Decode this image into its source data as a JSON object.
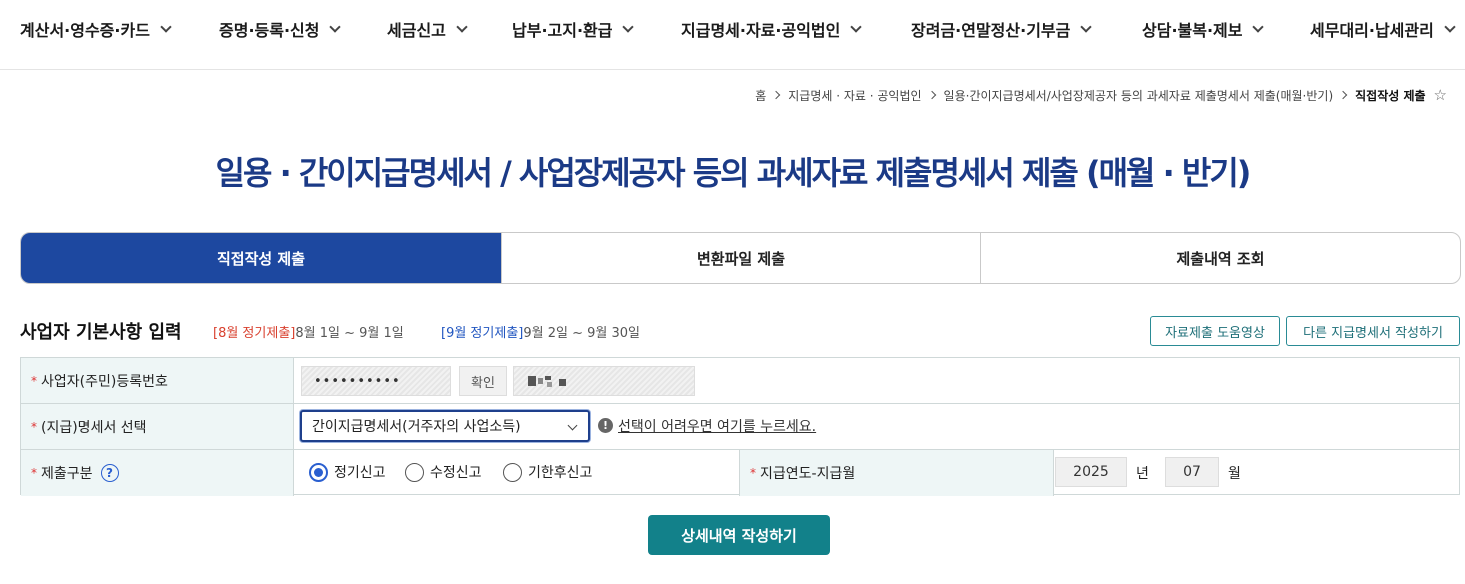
{
  "nav": {
    "items": [
      {
        "label": "계산서·영수증·카드"
      },
      {
        "label": "증명·등록·신청"
      },
      {
        "label": "세금신고"
      },
      {
        "label": "납부·고지·환급"
      },
      {
        "label": "지급명세·자료·공익법인"
      },
      {
        "label": "장려금·연말정산·기부금"
      },
      {
        "label": "상담·불복·제보"
      },
      {
        "label": "세무대리·납세관리"
      }
    ]
  },
  "breadcrumb": {
    "home": "홈",
    "level1": "지급명세 · 자료 · 공익법인",
    "level2": "일용·간이지급명세서/사업장제공자 등의 과세자료 제출명세서 제출(매월·반기)",
    "current": "직접작성 제출"
  },
  "page_title": "일용 · 간이지급명세서 / 사업장제공자 등의 과세자료 제출명세서 제출 (매월 · 반기)",
  "tabs": [
    {
      "label": "직접작성 제출",
      "active": true
    },
    {
      "label": "변환파일 제출",
      "active": false
    },
    {
      "label": "제출내역 조회",
      "active": false
    }
  ],
  "section": {
    "title": "사업자 기본사항 입력",
    "aug_tag": "[8월 정기제출]",
    "aug_range": "8월 1일 ~ 9월 1일",
    "sep_tag": "[9월 정기제출]",
    "sep_range": "9월 2일 ~ 9월 30일",
    "video_button": "자료제출 도움영상",
    "other_button": "다른 지급명세서 작성하기"
  },
  "form": {
    "biz_no_label": "사업자(주민)등록번호",
    "biz_no_value": "••••••••••",
    "confirm_label": "확인",
    "statement_label": "(지급)명세서 선택",
    "statement_value": "간이지급명세서(거주자의 사업소득)",
    "help_text": "선택이 어려우면 여기를 누르세요.",
    "submit_type_label": "제출구분",
    "radios": [
      {
        "label": "정기신고",
        "checked": true
      },
      {
        "label": "수정신고",
        "checked": false
      },
      {
        "label": "기한후신고",
        "checked": false
      }
    ],
    "period_label": "지급연도-지급월",
    "year_value": "2025",
    "year_unit": "년",
    "month_value": "07",
    "month_unit": "월"
  },
  "submit_button": "상세내역 작성하기",
  "colors": {
    "accent_navy": "#1d48a0",
    "title_navy": "#1b3a86",
    "teal": "#12818a",
    "red_tag": "#d9412f",
    "blue_tag": "#2156c0"
  }
}
